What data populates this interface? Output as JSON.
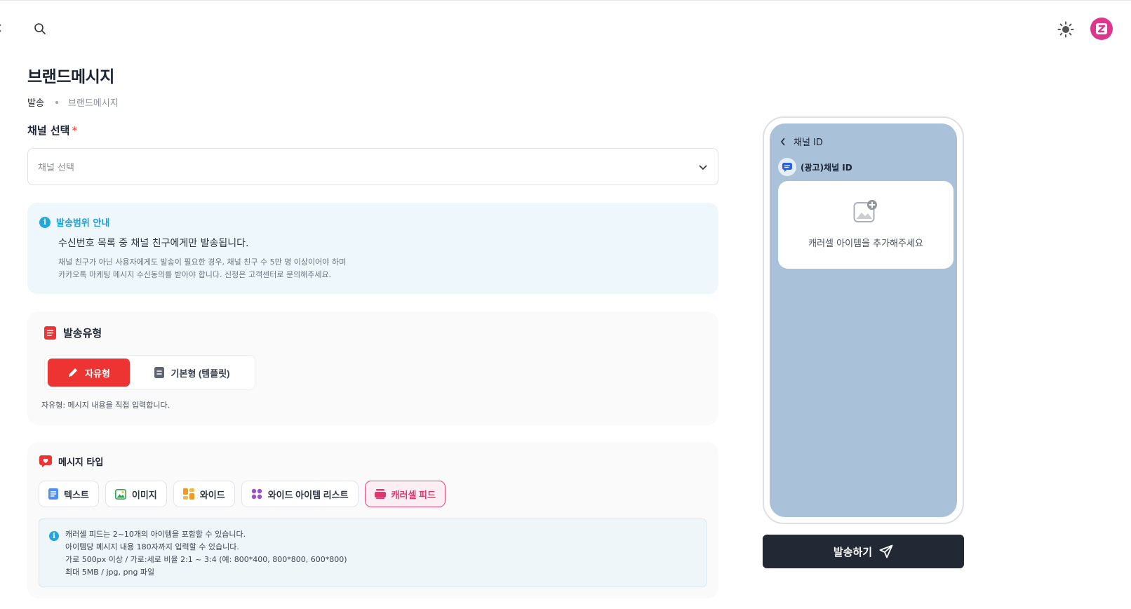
{
  "header": {
    "search_icon": "search-icon",
    "theme_icon": "sun-icon",
    "avatar_icon": "z-logo-icon",
    "avatar_color": "#e0358d"
  },
  "page": {
    "title": "브랜드메시지",
    "breadcrumb": [
      "발송",
      "브랜드메시지"
    ]
  },
  "channel": {
    "label": "채널 선택",
    "required_mark": "*",
    "placeholder": "채널 선택"
  },
  "scope_info": {
    "title": "발송범위 안내",
    "main": "수신번호 목록 중 채널 친구에게만 발송됩니다.",
    "sub_lines": [
      "채널 친구가 아닌 사용자에게도 발송이 필요한 경우, 채널 친구 수 5만 명 이상이어야 하며",
      "카카오톡 마케팅 메시지 수신동의를 받아야 합니다. 신청은 고객센터로 문의해주세요."
    ]
  },
  "send_type": {
    "title": "발송유형",
    "options": [
      {
        "label": "자유형",
        "icon": "pencil-icon",
        "selected": true
      },
      {
        "label": "기본형 (템플릿)",
        "icon": "document-icon",
        "selected": false
      }
    ],
    "description": "자유형: 메시지 내용을 직접 입력합니다."
  },
  "message_type": {
    "title": "메시지 타입",
    "options": [
      {
        "label": "텍스트",
        "icon": "text-icon",
        "selected": false
      },
      {
        "label": "이미지",
        "icon": "image-icon",
        "selected": false
      },
      {
        "label": "와이드",
        "icon": "wide-icon",
        "selected": false
      },
      {
        "label": "와이드 아이템 리스트",
        "icon": "grid-icon",
        "selected": false
      },
      {
        "label": "캐러셀 피드",
        "icon": "carousel-icon",
        "selected": true
      }
    ],
    "info_lines": [
      "캐러셀 피드는 2~10개의 아이템을 포함할 수 있습니다.",
      "아이템당 메시지 내용 180자까지 입력할 수 있습니다.",
      "가로 500px 이상 / 가로:세로 비율 2:1 ~ 3:4 (예: 800*400, 800*800, 600*800)",
      "최대 5MB / jpg, png 파일"
    ]
  },
  "preview": {
    "back_label": "채널 ID",
    "channel_name": "(광고)채널 ID",
    "empty_text": "캐러셀 아이템을 추가해주세요",
    "screen_color": "#a9c1d9"
  },
  "actions": {
    "send_label": "발송하기"
  },
  "colors": {
    "accent_red": "#ee3333",
    "accent_pink": "#e0356b",
    "info_blue": "#1aa1d6",
    "dark_button": "#222834"
  }
}
